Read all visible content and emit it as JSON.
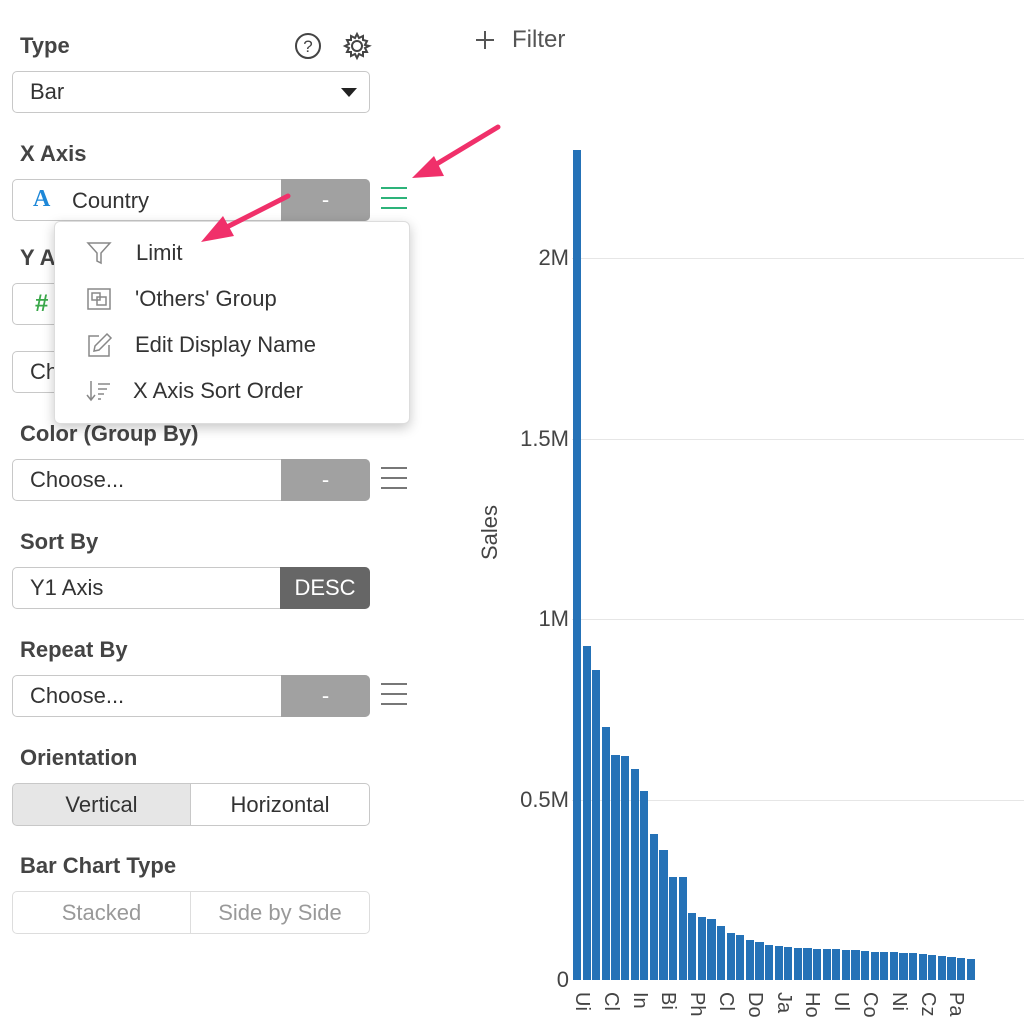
{
  "panel": {
    "type": {
      "label": "Type",
      "value": "Bar"
    },
    "x_axis": {
      "label": "X Axis",
      "type_glyph": "A",
      "value": "Country",
      "agg": "-"
    },
    "y_axis": {
      "label_visible": "Y A",
      "type_glyph": "#",
      "value_visible": "Ch"
    },
    "color": {
      "label": "Color (Group By)",
      "value": "Choose...",
      "agg": "-"
    },
    "sort_by": {
      "label": "Sort By",
      "value": "Y1 Axis",
      "order": "DESC"
    },
    "repeat_by": {
      "label": "Repeat By",
      "value": "Choose...",
      "agg": "-"
    },
    "orientation": {
      "label": "Orientation",
      "options": [
        "Vertical",
        "Horizontal"
      ],
      "selected": "Vertical"
    },
    "bar_chart_type": {
      "label": "Bar Chart Type",
      "options": [
        "Stacked",
        "Side by Side"
      ]
    }
  },
  "menu": {
    "items": [
      {
        "label": "Limit",
        "icon": "funnel-icon"
      },
      {
        "label": "'Others' Group",
        "icon": "group-icon"
      },
      {
        "label": "Edit Display Name",
        "icon": "edit-icon"
      },
      {
        "label": "X Axis Sort Order",
        "icon": "sort-icon"
      }
    ]
  },
  "toolbar": {
    "filter_label": "Filter"
  },
  "colors": {
    "bar": "#2572b7",
    "accent_green": "#2db37a",
    "arrow": "#f0306a"
  },
  "chart_data": {
    "type": "bar",
    "ylabel": "Sales",
    "yticks": [
      "0",
      "0.5M",
      "1M",
      "1.5M",
      "2M"
    ],
    "ylim": [
      0,
      2300000
    ],
    "xtick_labels_visible": [
      "Ui",
      "Cl",
      "In",
      "Bi",
      "Ph",
      "Cl",
      "Do",
      "Ja",
      "Ho",
      "Ul",
      "Co",
      "Ni",
      "Cz",
      "Pa"
    ],
    "values": [
      2300000,
      925000,
      860000,
      700000,
      625000,
      620000,
      585000,
      525000,
      405000,
      360000,
      285000,
      285000,
      185000,
      175000,
      170000,
      150000,
      130000,
      125000,
      110000,
      105000,
      97000,
      95000,
      92000,
      90000,
      88000,
      87000,
      86000,
      85000,
      83000,
      82000,
      80000,
      79000,
      78000,
      77000,
      76000,
      74000,
      72000,
      70000,
      66000,
      64000,
      61000,
      59000
    ]
  }
}
